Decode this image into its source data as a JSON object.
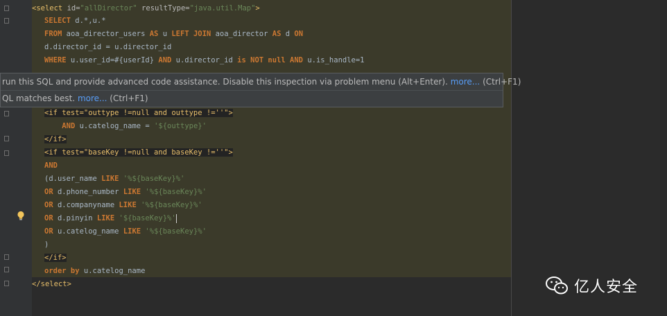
{
  "code": {
    "lines": [
      [
        {
          "t": "<select ",
          "c": "tag"
        },
        {
          "t": "id=",
          "c": "attr"
        },
        {
          "t": "\"allDirector\"",
          "c": "str"
        },
        {
          "t": " resultType=",
          "c": "attr"
        },
        {
          "t": "\"java.util.Map\"",
          "c": "str"
        },
        {
          "t": ">",
          "c": "tag"
        }
      ],
      [
        {
          "t": "SELECT",
          "c": "kw"
        },
        {
          "t": " d.*,u.*",
          "c": "plain"
        }
      ],
      [
        {
          "t": "FROM",
          "c": "kw"
        },
        {
          "t": " aoa_director_users ",
          "c": "plain"
        },
        {
          "t": "AS",
          "c": "kw"
        },
        {
          "t": " u ",
          "c": "plain"
        },
        {
          "t": "LEFT JOIN",
          "c": "kw"
        },
        {
          "t": " aoa_director ",
          "c": "plain"
        },
        {
          "t": "AS",
          "c": "kw"
        },
        {
          "t": " d ",
          "c": "plain"
        },
        {
          "t": "ON",
          "c": "kw"
        }
      ],
      [
        {
          "t": "d.director_id = u.director_id",
          "c": "plain"
        }
      ],
      [
        {
          "t": "WHERE",
          "c": "kw"
        },
        {
          "t": " u.user_id=#{userId} ",
          "c": "plain"
        },
        {
          "t": "AND",
          "c": "kw"
        },
        {
          "t": " u.director_id ",
          "c": "plain"
        },
        {
          "t": "is NOT null AND",
          "c": "kw"
        },
        {
          "t": " u.is_handle=1",
          "c": "plain"
        }
      ],
      [
        {
          "t": "<if test=\"outtype !=null and outtype !=''\">",
          "c": "tag",
          "hl": true
        }
      ],
      [
        {
          "t": "    ",
          "c": "plain"
        },
        {
          "t": "AND",
          "c": "kw"
        },
        {
          "t": " u.catelog_name = ",
          "c": "plain"
        },
        {
          "t": "'${outtype}'",
          "c": "str"
        }
      ],
      [
        {
          "t": "</if>",
          "c": "tag",
          "hl": true
        }
      ],
      [
        {
          "t": "<if test=\"baseKey !=null and baseKey !=''\">",
          "c": "tag",
          "hl": true
        }
      ],
      [
        {
          "t": "AND",
          "c": "kw"
        }
      ],
      [
        {
          "t": "(d.user_name ",
          "c": "plain"
        },
        {
          "t": "LIKE",
          "c": "kw"
        },
        {
          "t": " '%${baseKey}%'",
          "c": "str"
        }
      ],
      [
        {
          "t": "OR",
          "c": "kw"
        },
        {
          "t": " d.phone_number ",
          "c": "plain"
        },
        {
          "t": "LIKE",
          "c": "kw"
        },
        {
          "t": " '%${baseKey}%'",
          "c": "str"
        }
      ],
      [
        {
          "t": "OR",
          "c": "kw"
        },
        {
          "t": " d.companyname ",
          "c": "plain"
        },
        {
          "t": "LIKE",
          "c": "kw"
        },
        {
          "t": " '%${baseKey}%'",
          "c": "str"
        }
      ],
      [
        {
          "t": "OR",
          "c": "kw"
        },
        {
          "t": " d.pinyin ",
          "c": "plain"
        },
        {
          "t": "LIKE",
          "c": "kw"
        },
        {
          "t": " '${baseKey}%'",
          "c": "str"
        },
        {
          "t": "",
          "c": "caret"
        }
      ],
      [
        {
          "t": "OR",
          "c": "kw"
        },
        {
          "t": " u.catelog_name ",
          "c": "plain"
        },
        {
          "t": "LIKE",
          "c": "kw"
        },
        {
          "t": " '%${baseKey}%'",
          "c": "str"
        }
      ],
      [
        {
          "t": ")",
          "c": "plain"
        }
      ],
      [
        {
          "t": "</if>",
          "c": "tag",
          "hl": true
        }
      ],
      [
        {
          "t": "order by",
          "c": "kw"
        },
        {
          "t": " u.catelog_name",
          "c": "plain"
        }
      ],
      [
        {
          "t": "</select>",
          "c": "tag"
        }
      ]
    ]
  },
  "tooltip": {
    "line1_text": "run this SQL and provide advanced code assistance. Disable this inspection via problem menu (Alt+Enter). ",
    "line1_link": "more...",
    "line1_shortcut": " (Ctrl+F1)",
    "line2_text": "QL matches best. ",
    "line2_link": "more...",
    "line2_shortcut": " (Ctrl+F1)"
  },
  "watermark": {
    "text": "亿人安全",
    "icon": "wechat-icon"
  },
  "gutter": {
    "icon": "intention-bulb-icon"
  },
  "colors": {
    "keyword": "#cc7832",
    "tag": "#e8bf6a",
    "string": "#6a8759",
    "identifier": "#a9b7c6",
    "link": "#589df6"
  }
}
